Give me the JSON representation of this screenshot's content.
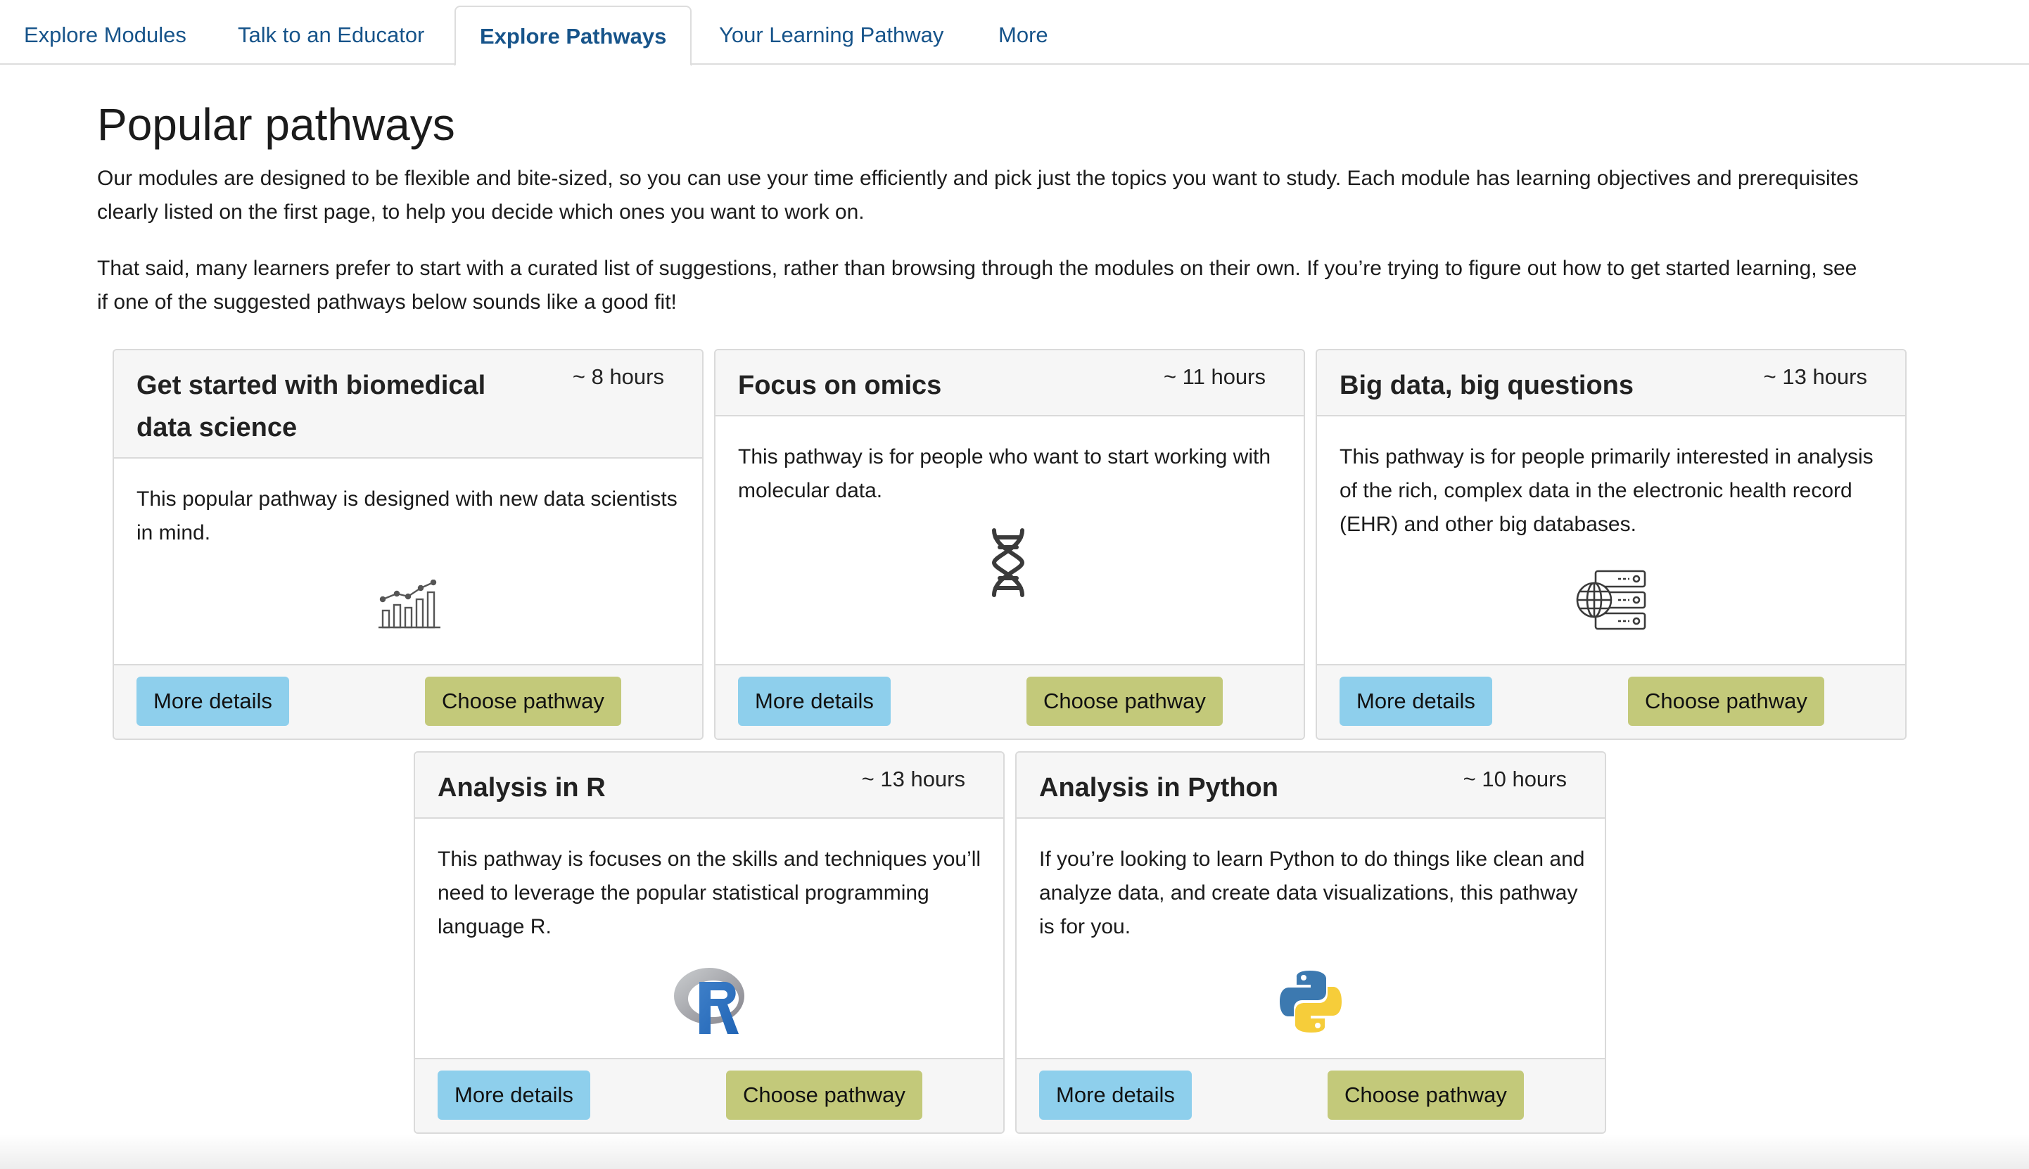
{
  "tabs": [
    {
      "label": "Explore Modules",
      "active": false
    },
    {
      "label": "Talk to an Educator",
      "active": false
    },
    {
      "label": "Explore Pathways",
      "active": true
    },
    {
      "label": "Your Learning Pathway",
      "active": false
    },
    {
      "label": "More",
      "active": false
    }
  ],
  "main": {
    "title": "Popular pathways",
    "intro_1": "Our modules are designed to be flexible and bite-sized, so you can use your time efficiently and pick just the topics you want to study. Each module has learning objectives and prerequisites clearly listed on the first page, to help you decide which ones you want to work on.",
    "intro_2": "That said, many learners prefer to start with a curated list of suggestions, rather than browsing through the modules on their own. If you’re trying to figure out how to get started learning, see if one of the suggested pathways below sounds like a good fit!"
  },
  "pathways": [
    {
      "title": "Get started with biomedical data science",
      "hours": "~ 8 hours",
      "description": "This popular pathway is designed with new data scientists in mind.",
      "icon": "bar-chart-trend-icon",
      "details_label": "More details",
      "choose_label": "Choose pathway"
    },
    {
      "title": "Focus on omics",
      "hours": "~ 11 hours",
      "description": "This pathway is for people who want to start working with molecular data.",
      "icon": "dna-icon",
      "details_label": "More details",
      "choose_label": "Choose pathway"
    },
    {
      "title": "Big data, big questions",
      "hours": "~ 13 hours",
      "description": "This pathway is for people primarily interested in analysis of the rich, complex data in the electronic health record (EHR) and other big databases.",
      "icon": "database-globe-icon",
      "details_label": "More details",
      "choose_label": "Choose pathway"
    },
    {
      "title": "Analysis in R",
      "hours": "~ 13 hours",
      "description": "This pathway is focuses on the skills and techniques you’ll need to leverage the popular statistical programming language R.",
      "icon": "r-logo-icon",
      "details_label": "More details",
      "choose_label": "Choose pathway"
    },
    {
      "title": "Analysis in Python",
      "hours": "~ 10 hours",
      "description": "If you’re looking to learn Python to do things like clean and analyze data, and create data visualizations, this pathway is for you.",
      "icon": "python-logo-icon",
      "details_label": "More details",
      "choose_label": "Choose pathway"
    }
  ],
  "colors": {
    "tab_text": "#17548a",
    "details_button": "#8ecfec",
    "choose_button": "#c3c97a",
    "card_header_bg": "#f6f6f6"
  }
}
